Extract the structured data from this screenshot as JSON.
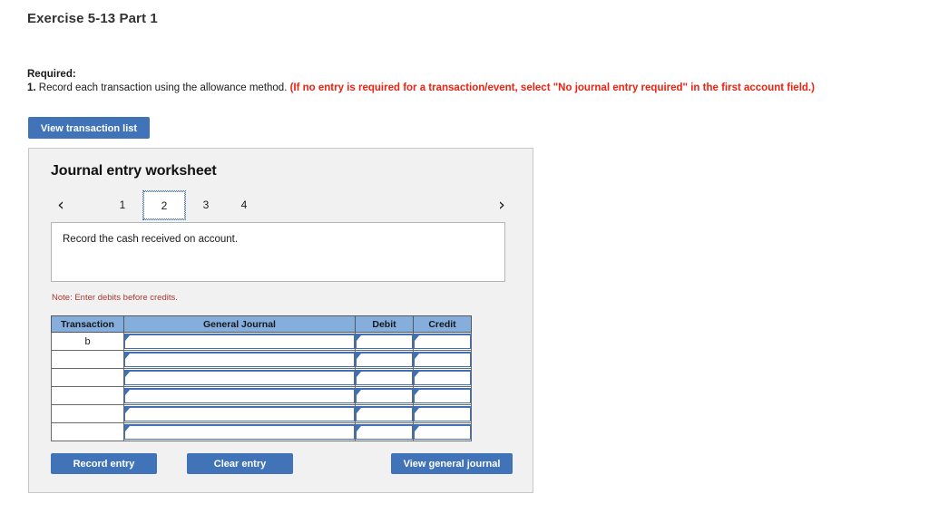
{
  "page": {
    "exercise_title": "Exercise 5-13 Part 1"
  },
  "required": {
    "label": "Required:",
    "number": "1.",
    "instruction": " Record each transaction using the allowance method. ",
    "hint": "(If no entry is required for a transaction/event, select \"No journal entry required\" in the first account field.)"
  },
  "toolbar": {
    "view_transaction_list_label": "View transaction list"
  },
  "worksheet": {
    "title": "Journal entry worksheet",
    "nav": {
      "prev_icon": "chevron-left",
      "prev_glyph": "‹",
      "next_icon": "chevron-right",
      "next_glyph": "›"
    },
    "tabs": [
      {
        "label": "1",
        "active": false
      },
      {
        "label": "2",
        "active": true
      },
      {
        "label": "3",
        "active": false
      },
      {
        "label": "4",
        "active": false
      }
    ],
    "prompt": "Record the cash received on account.",
    "note": "Note: Enter debits before credits.",
    "table": {
      "headers": [
        "Transaction",
        "General Journal",
        "Debit",
        "Credit"
      ],
      "rows": [
        {
          "transaction": "b",
          "general_journal": "",
          "debit": "",
          "credit": ""
        },
        {
          "transaction": "",
          "general_journal": "",
          "debit": "",
          "credit": ""
        },
        {
          "transaction": "",
          "general_journal": "",
          "debit": "",
          "credit": ""
        },
        {
          "transaction": "",
          "general_journal": "",
          "debit": "",
          "credit": ""
        },
        {
          "transaction": "",
          "general_journal": "",
          "debit": "",
          "credit": ""
        },
        {
          "transaction": "",
          "general_journal": "",
          "debit": "",
          "credit": ""
        }
      ]
    },
    "actions": {
      "record_entry_label": "Record entry",
      "clear_entry_label": "Clear entry",
      "view_general_journal_label": "View general journal"
    }
  },
  "colors": {
    "button_blue": "#4173b8",
    "table_header_blue": "#85aedd",
    "field_border_blue": "#3f6fb5",
    "panel_gray": "#f1f1f1",
    "hint_red": "#ee2211",
    "note_red": "#a63a32"
  }
}
